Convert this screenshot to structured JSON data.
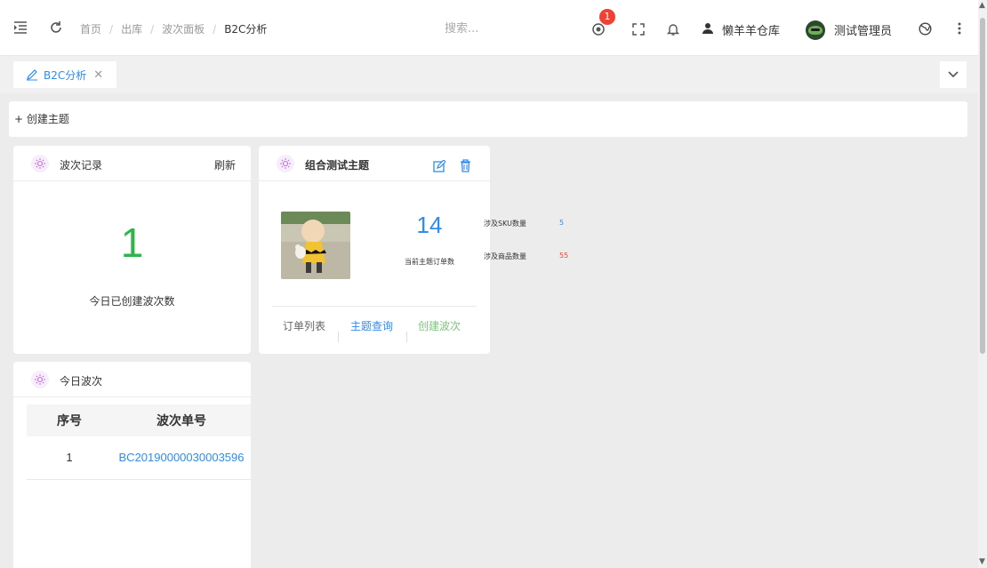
{
  "header": {
    "breadcrumbs": [
      "首页",
      "出库",
      "波次面板",
      "B2C分析"
    ],
    "search_placeholder": "搜索...",
    "notification_badge": "1",
    "warehouse": "懒羊羊仓库",
    "user_name": "测试管理员"
  },
  "tabs": [
    {
      "label": "B2C分析",
      "active": true
    }
  ],
  "toolbar": {
    "create_topic_label": "+ 创建主题"
  },
  "wave_record_card": {
    "title": "波次记录",
    "refresh_label": "刷新",
    "count": "1",
    "caption": "今日已创建波次数"
  },
  "topic_card": {
    "title": "组合测试主题",
    "order_count": "14",
    "order_caption": "当前主题订单数",
    "stats": [
      {
        "label": "涉及SKU数量",
        "value": "5",
        "color": "#2d8cf0"
      },
      {
        "label": "涉及商品数量",
        "value": "55",
        "color": "#f04134"
      }
    ],
    "actions": [
      {
        "label": "订单列表",
        "color": "#666666"
      },
      {
        "label": "主题查询",
        "color": "#2d8cf0"
      },
      {
        "label": "创建波次",
        "color": "#7cc47f"
      }
    ]
  },
  "today_waves_card": {
    "title": "今日波次",
    "columns": [
      "序号",
      "波次单号"
    ],
    "rows": [
      {
        "index": "1",
        "wave_no": "BC20190000030003596"
      }
    ]
  },
  "colors": {
    "accent": "#2d8cf0",
    "count_green": "#2fb54a",
    "danger": "#f04134",
    "bulb": "#c06bd6"
  }
}
